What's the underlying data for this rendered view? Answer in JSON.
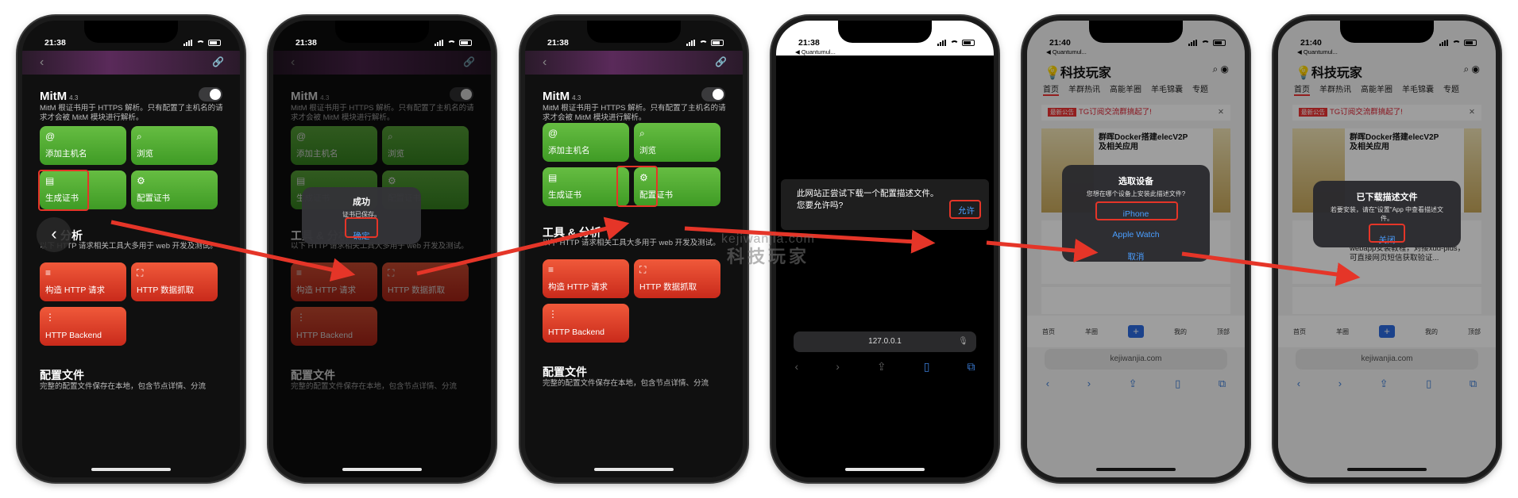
{
  "watermark": {
    "line1": "kejiwanjia.com",
    "line2": "科技玩家"
  },
  "phone1": {
    "time": "21:38",
    "mitm_title": "MitM",
    "mitm_version": "4.3",
    "mitm_desc": "MitM 根证书用于 HTTPS 解析。只有配置了主机名的请求才会被 MitM 模块进行解析。",
    "tiles": [
      "添加主机名",
      "浏览",
      "生成证书",
      "配置证书"
    ],
    "tools_title": "工具 & 分析",
    "tools_desc": "以下 HTTP 请求相关工具大多用于 web 开发及测试。",
    "tools": [
      "构造 HTTP 请求",
      "HTTP 数据抓取",
      "HTTP Backend"
    ],
    "config_title": "配置文件",
    "config_desc": "完整的配置文件保存在本地，包含节点详情、分流"
  },
  "phone2": {
    "time": "21:38",
    "alert_title": "成功",
    "alert_msg": "证书已保存。",
    "alert_ok": "确定"
  },
  "phone3": {
    "time": "21:38"
  },
  "phone4": {
    "time": "21:38",
    "back_app": "◀ Quantumul...",
    "prompt_line1": "此网站正尝试下载一个配置描述文件。",
    "prompt_line2": "您要允许吗?",
    "allow": "允许",
    "url": "127.0.0.1"
  },
  "phone5": {
    "time": "21:40",
    "back_app": "◀ Quantumul...",
    "site_title": "科技玩家",
    "nav": [
      "首页",
      "羊群热讯",
      "高能羊圈",
      "羊毛锦囊",
      "专题"
    ],
    "notice_tag": "最新公告",
    "notice": "TG订阅交流群搞起了!",
    "card_title": "群晖Docker搭建elecV2P及相关应用",
    "sheet_title": "选取设备",
    "sheet_msg": "您想在哪个设备上安装此描述文件?",
    "opt_iphone": "iPhone",
    "opt_watch": "Apple Watch",
    "cancel": "取消",
    "url": "kejiwanjia.com",
    "bottom_nav": [
      "首页",
      "羊圈",
      "+",
      "我的",
      "顶部"
    ]
  },
  "phone6": {
    "time": "21:40",
    "back_app": "◀ Quantumul...",
    "sheet_title": "已下载描述文件",
    "sheet_msg": "若要安装，请在\"设置\"App 中查看描述文件。",
    "close": "关闭",
    "card_text": "webapp安装教程，对接xdd-plus，可直接网页短信获取验证..."
  },
  "colors": {
    "red": "#e53528",
    "green": "#4fae2f",
    "orange": "#e0432a",
    "ios_blue": "#4a9eff"
  }
}
